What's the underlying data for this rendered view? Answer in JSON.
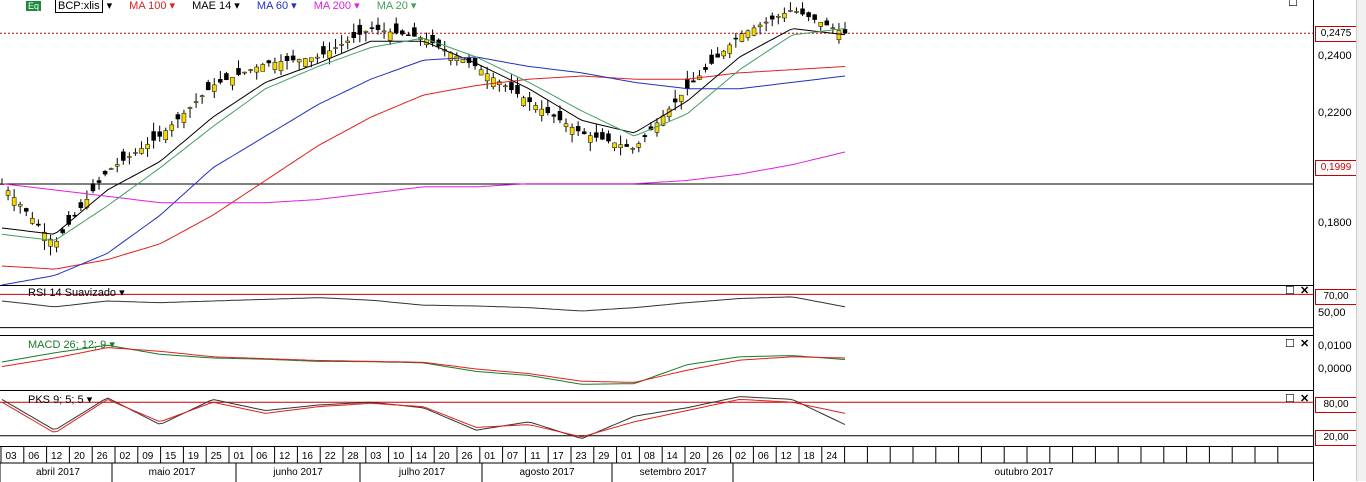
{
  "main": {
    "symbol_badge": "Eq",
    "symbol": "BCP:xlis",
    "indicators": [
      {
        "label": "MA 100",
        "color": "#e02020"
      },
      {
        "label": "MAE 14",
        "color": "#000000"
      },
      {
        "label": "MA 60",
        "color": "#2030c0"
      },
      {
        "label": "MA 200",
        "color": "#e020e0"
      },
      {
        "label": "MA 20",
        "color": "#40a060"
      }
    ],
    "y_ticks": [
      "0,2400",
      "0,2200",
      "0,1800"
    ],
    "last_price": "0,2475",
    "ref_price": "0,1999"
  },
  "rsi": {
    "label": "RSI 14 Suavizado",
    "levels": [
      "70,00",
      "50,00"
    ]
  },
  "macd": {
    "label": "MACD 26; 12; 9",
    "levels": [
      "0,0100",
      "0,0000"
    ]
  },
  "pks": {
    "label": "PKS 9; 5; 5",
    "levels": [
      "80,00",
      "20,00"
    ]
  },
  "x_axis": {
    "days": [
      "03",
      "06",
      "12",
      "20",
      "26",
      "02",
      "09",
      "15",
      "19",
      "25",
      "01",
      "06",
      "12",
      "16",
      "22",
      "28",
      "03",
      "10",
      "14",
      "20",
      "26",
      "01",
      "07",
      "11",
      "17",
      "23",
      "29",
      "01",
      "08",
      "14",
      "20",
      "26",
      "02",
      "06",
      "12",
      "18",
      "24"
    ],
    "months": [
      "abril 2017",
      "maio 2017",
      "junho 2017",
      "julho 2017",
      "agosto 2017",
      "setembro 2017",
      "outubro 2017"
    ]
  },
  "chart_data": [
    {
      "type": "candlestick",
      "symbol": "BCP:xlis",
      "ylim": [
        0.168,
        0.258
      ],
      "x": [
        "2017-04-03",
        "2017-04-17",
        "2017-05-02",
        "2017-05-15",
        "2017-06-01",
        "2017-06-15",
        "2017-07-03",
        "2017-07-14",
        "2017-07-26",
        "2017-08-07",
        "2017-08-17",
        "2017-08-29",
        "2017-09-08",
        "2017-09-20",
        "2017-10-02",
        "2017-10-12",
        "2017-10-24"
      ],
      "close": [
        0.2,
        0.181,
        0.204,
        0.215,
        0.231,
        0.238,
        0.24,
        0.249,
        0.246,
        0.237,
        0.226,
        0.216,
        0.211,
        0.23,
        0.247,
        0.255,
        0.2475
      ],
      "series": [
        {
          "name": "MA 100",
          "values": [
            0.174,
            0.173,
            0.176,
            0.181,
            0.19,
            0.201,
            0.212,
            0.221,
            0.228,
            0.231,
            0.233,
            0.234,
            0.233,
            0.233,
            0.235,
            0.236,
            0.237
          ]
        },
        {
          "name": "MAE 14",
          "values": [
            0.186,
            0.184,
            0.198,
            0.207,
            0.221,
            0.232,
            0.238,
            0.245,
            0.245,
            0.238,
            0.23,
            0.22,
            0.216,
            0.226,
            0.24,
            0.249,
            0.247
          ]
        },
        {
          "name": "MA 60",
          "values": [
            0.168,
            0.171,
            0.178,
            0.19,
            0.205,
            0.215,
            0.225,
            0.233,
            0.239,
            0.24,
            0.237,
            0.235,
            0.232,
            0.23,
            0.23,
            0.232,
            0.234
          ]
        },
        {
          "name": "MA 200",
          "values": [
            0.2,
            0.198,
            0.196,
            0.194,
            0.194,
            0.194,
            0.195,
            0.197,
            0.199,
            0.199,
            0.2,
            0.2,
            0.2,
            0.201,
            0.203,
            0.206,
            0.21
          ]
        },
        {
          "name": "MA 20",
          "values": [
            0.184,
            0.182,
            0.193,
            0.205,
            0.218,
            0.23,
            0.237,
            0.243,
            0.246,
            0.24,
            0.232,
            0.223,
            0.215,
            0.222,
            0.236,
            0.247,
            0.249
          ]
        }
      ],
      "reference_lines": [
        0.2475,
        0.1999
      ]
    },
    {
      "type": "line",
      "title": "RSI 14 Suavizado",
      "ylim": [
        20,
        80
      ],
      "levels": [
        70,
        30
      ],
      "values": [
        62,
        55,
        62,
        60,
        62,
        64,
        66,
        63,
        57,
        56,
        54,
        50,
        54,
        60,
        65,
        67,
        55
      ]
    },
    {
      "type": "line",
      "title": "MACD 26; 12; 9",
      "ylim": [
        -0.004,
        0.014
      ],
      "series": [
        {
          "name": "MACD",
          "values": [
            0.0055,
            0.0085,
            0.011,
            0.008,
            0.0068,
            0.0064,
            0.0057,
            0.0056,
            0.0052,
            0.0024,
            0.0011,
            -0.0018,
            -0.0016,
            0.0046,
            0.0072,
            0.0076,
            0.0063
          ]
        },
        {
          "name": "Signal",
          "values": [
            0.004,
            0.0068,
            0.0102,
            0.009,
            0.0072,
            0.0066,
            0.006,
            0.0057,
            0.0054,
            0.0032,
            0.0017,
            -0.0008,
            -0.0012,
            0.0028,
            0.0061,
            0.0072,
            0.0068
          ]
        }
      ]
    },
    {
      "type": "line",
      "title": "PKS 9; 5; 5",
      "ylim": [
        0,
        100
      ],
      "levels": [
        80,
        20
      ],
      "series": [
        {
          "name": "%K",
          "values": [
            85,
            30,
            88,
            40,
            85,
            65,
            75,
            80,
            70,
            30,
            45,
            15,
            55,
            70,
            90,
            85,
            40
          ]
        },
        {
          "name": "%D",
          "values": [
            80,
            25,
            85,
            45,
            80,
            60,
            72,
            78,
            72,
            35,
            40,
            18,
            45,
            65,
            85,
            80,
            60
          ]
        }
      ]
    }
  ]
}
